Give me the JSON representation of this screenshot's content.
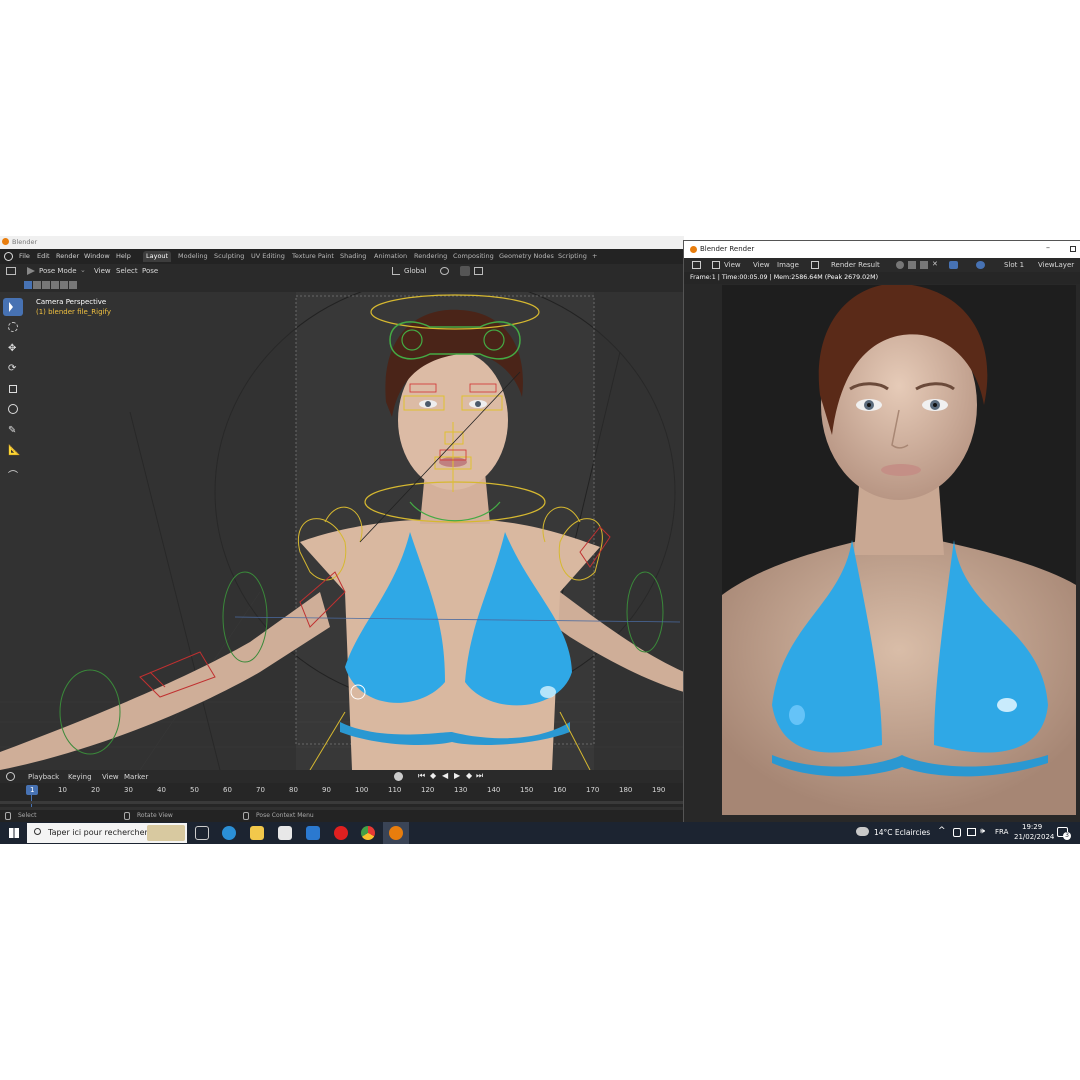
{
  "blender": {
    "title": "Blender",
    "menus": [
      "File",
      "Edit",
      "Render",
      "Window",
      "Help"
    ],
    "workspaces": [
      "Layout",
      "Modeling",
      "Sculpting",
      "UV Editing",
      "Texture Paint",
      "Shading",
      "Animation",
      "Rendering",
      "Compositing",
      "Geometry Nodes",
      "Scripting"
    ],
    "active_workspace": "Layout",
    "add_workspace": "+",
    "header": {
      "mode": "Pose Mode",
      "menus": [
        "View",
        "Select",
        "Pose"
      ],
      "orientation": "Global"
    },
    "viewport": {
      "camera_label": "Camera Perspective",
      "object_label": "(1) blender file_Rigify"
    },
    "timeline": {
      "menus": [
        "Playback",
        "Keying",
        "View",
        "Marker"
      ],
      "current_frame": "1",
      "ticks": [
        "10",
        "20",
        "30",
        "40",
        "50",
        "60",
        "70",
        "80",
        "90",
        "100",
        "110",
        "120",
        "130",
        "140",
        "150",
        "160",
        "170",
        "180",
        "190"
      ]
    },
    "status": {
      "select": "Select",
      "rotate": "Rotate View",
      "context": "Pose Context Menu"
    }
  },
  "render_window": {
    "title": "Blender Render",
    "toolbar": {
      "view1": "View",
      "view2": "View",
      "image": "Image",
      "result": "Render Result",
      "slot": "Slot 1",
      "layer": "ViewLayer"
    },
    "info": "Frame:1 | Time:00:05.09 | Mem:2586.64M (Peak 2679.02M)"
  },
  "taskbar": {
    "search_placeholder": "Taper ici pour rechercher",
    "weather": "14°C  Eclaircies",
    "language": "FRA",
    "time": "19:29",
    "date": "21/02/2024",
    "notifications": "3"
  },
  "colors": {
    "accent": "#4772b3",
    "bikini": "#2fa8e6",
    "rig_yellow": "#e0c030",
    "rig_green": "#44aa44",
    "skin": "#d9b8a0"
  }
}
